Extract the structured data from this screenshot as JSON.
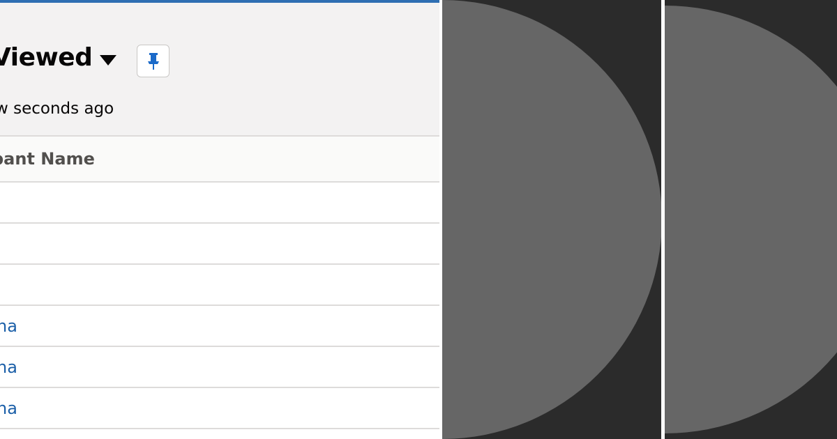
{
  "list_view": {
    "title": "Viewed",
    "updated": "w seconds ago",
    "column_header": "pant Name",
    "rows": [
      {
        "name": ""
      },
      {
        "name": ""
      },
      {
        "name": ""
      },
      {
        "name": "na"
      },
      {
        "name": "na"
      },
      {
        "name": "na"
      }
    ]
  },
  "icons": {
    "dropdown": "caret-down-icon",
    "pin": "pin-icon"
  },
  "colors": {
    "accent": "#2f6fb3",
    "link": "#1b5fa8",
    "header_bg": "#f3f2f2",
    "dark_bg": "#2b2b2b",
    "circle": "#666666"
  }
}
